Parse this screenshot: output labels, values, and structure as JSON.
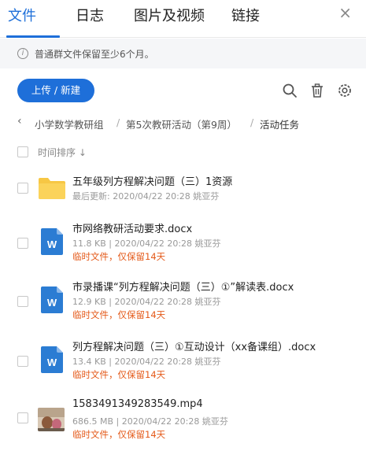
{
  "tabs": [
    {
      "label": "文件",
      "active": true
    },
    {
      "label": "日志",
      "active": false
    },
    {
      "label": "图片及视频",
      "active": false
    },
    {
      "label": "链接",
      "active": false
    }
  ],
  "close_icon": "×",
  "notice": {
    "text": "普通群文件保留至少6个月。",
    "icon": "info-icon"
  },
  "toolbar": {
    "upload_label": "上传 / 新建",
    "icons": [
      "search-icon",
      "trash-icon",
      "gear-icon"
    ]
  },
  "breadcrumb": {
    "back": "‹",
    "items": [
      "小学数学教研组",
      "第5次教研活动（第9周）",
      "活动任务"
    ],
    "separator": "/"
  },
  "sort": {
    "label": "时间排序 ↓"
  },
  "files": [
    {
      "type": "folder",
      "name": "五年级列方程解决问题（三）1资源",
      "meta": "最后更新: 2020/04/22 20:28  姚亚芬",
      "temp": ""
    },
    {
      "type": "word",
      "name": "市网络教研活动要求.docx",
      "meta": "11.8 KB  |  2020/04/22 20:28  姚亚芬",
      "temp": "临时文件，仅保留14天"
    },
    {
      "type": "word",
      "name": "市录播课“列方程解决问题（三）①”解读表.docx",
      "meta": "12.9 KB  |  2020/04/22 20:28  姚亚芬",
      "temp": "临时文件，仅保留14天"
    },
    {
      "type": "word",
      "name": "列方程解决问题（三）①互动设计（xx备课组）.docx",
      "meta": "13.4 KB  |  2020/04/22 20:28  姚亚芬",
      "temp": "临时文件，仅保留14天"
    },
    {
      "type": "video",
      "name": "1583491349283549.mp4",
      "meta": "686.5 MB  |  2020/04/22 20:28  姚亚芬",
      "temp": "临时文件，仅保留14天"
    }
  ],
  "colors": {
    "accent": "#1e6fd9",
    "warning": "#e45a1a",
    "folder": "#f7c744",
    "word": "#2b7cd3"
  }
}
